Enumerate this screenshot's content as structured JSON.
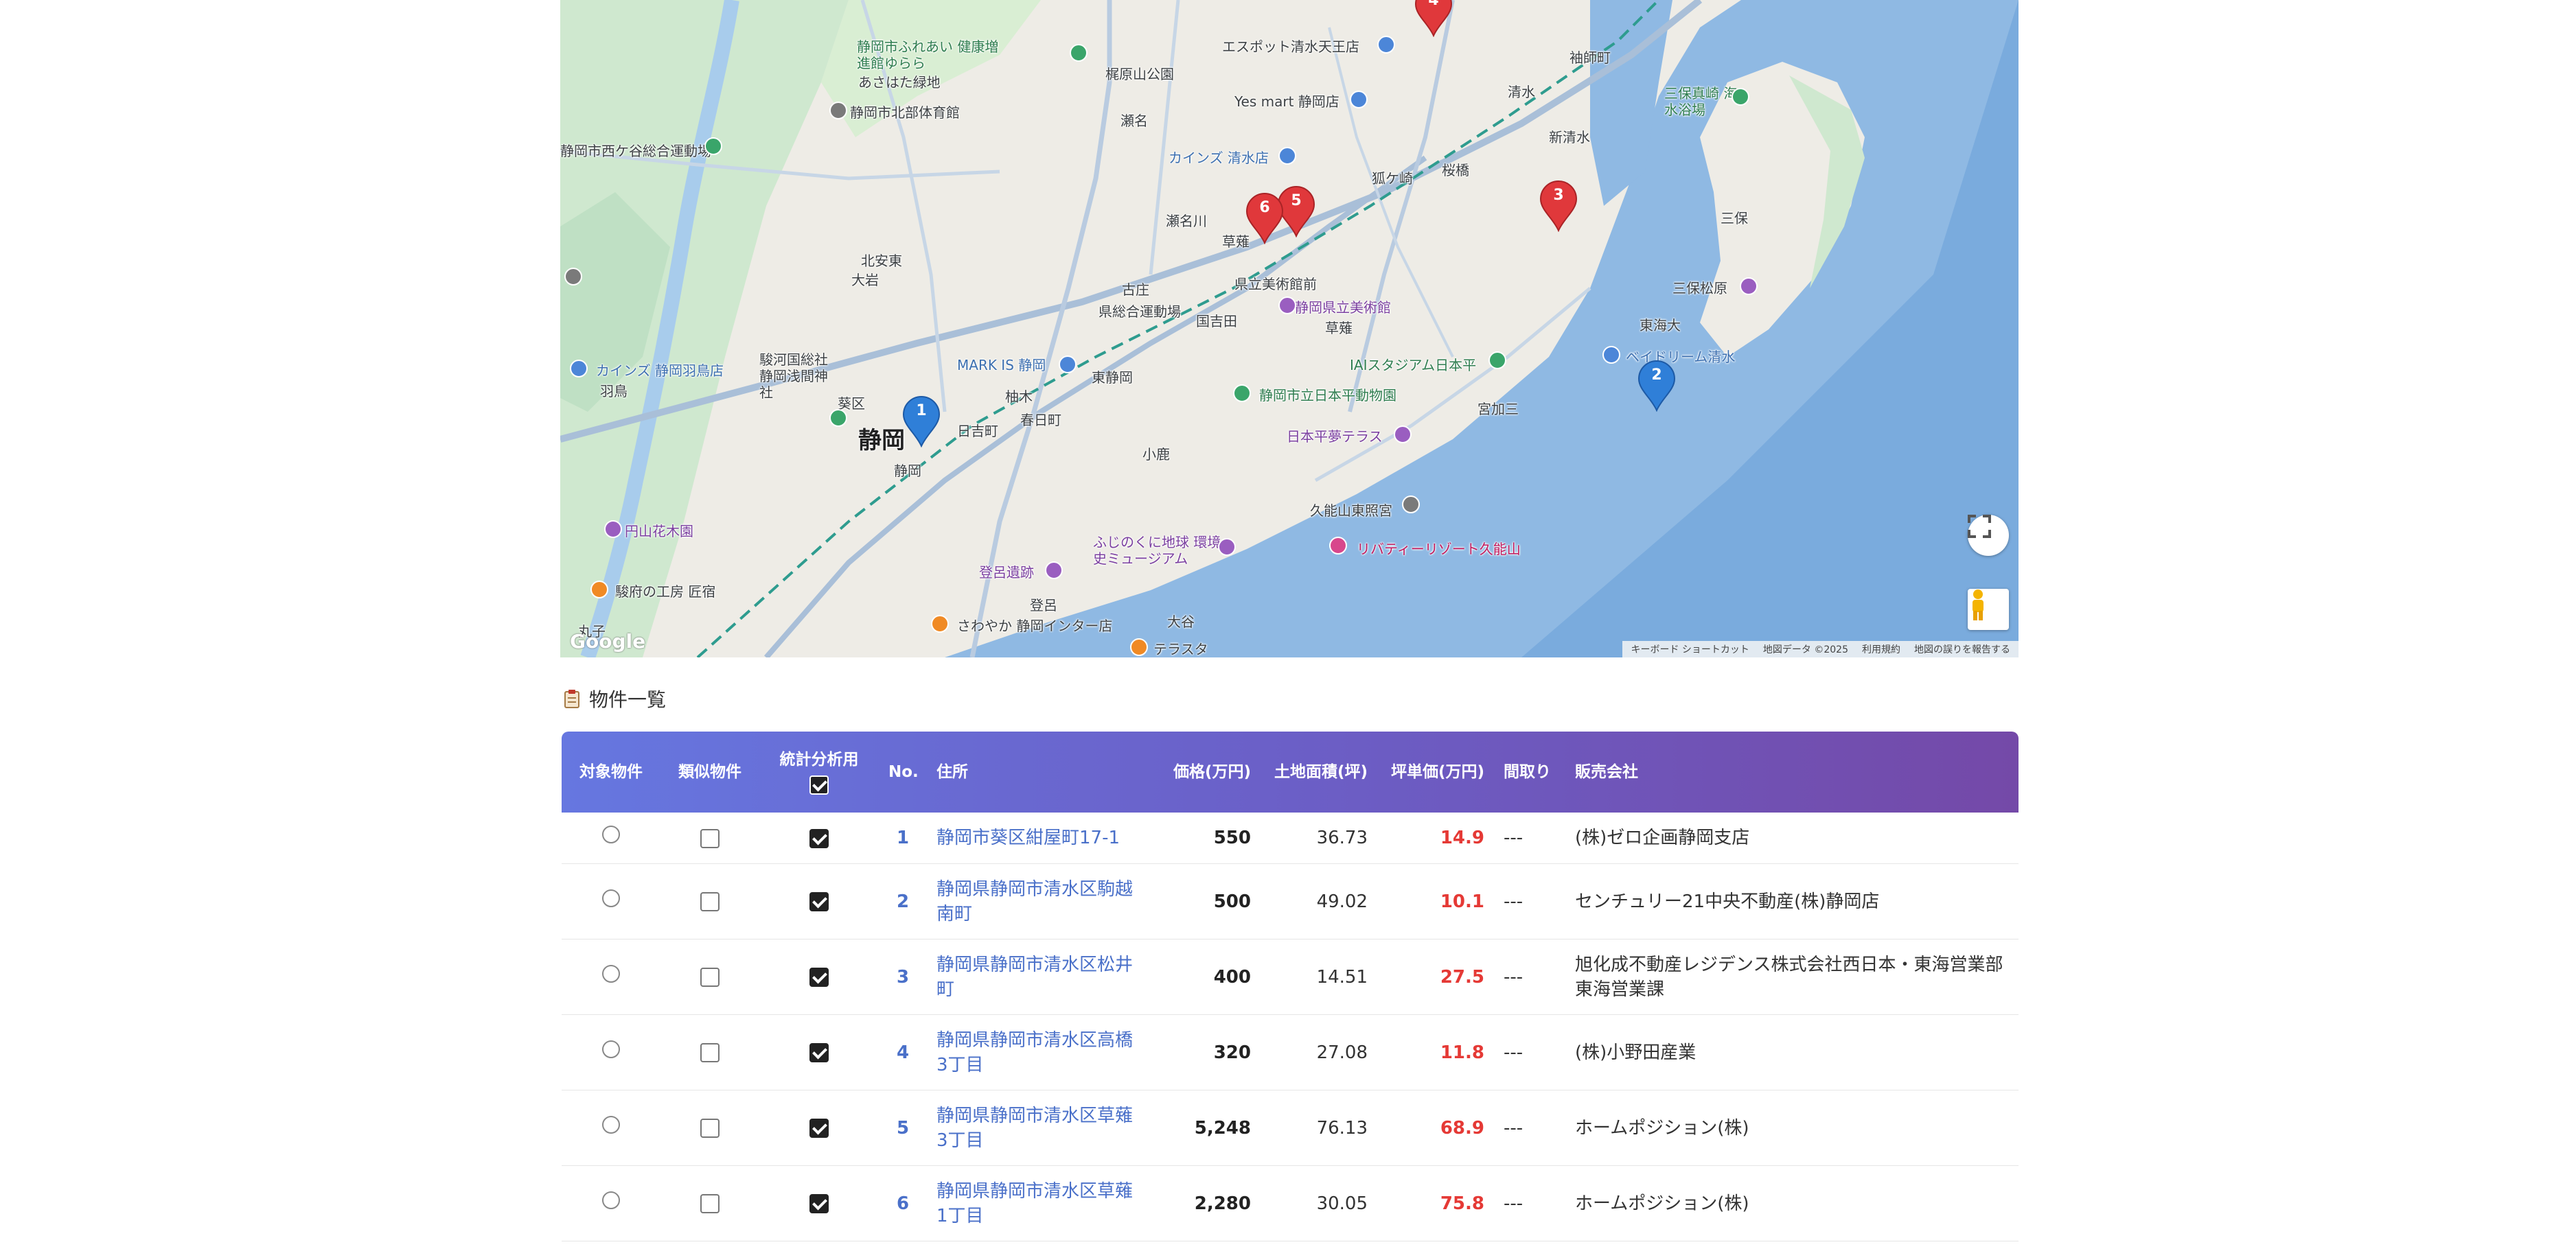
{
  "map": {
    "labels": {
      "shizuoka": "静岡",
      "shizuoka_station": "静岡",
      "hiyoshicho": "日吉町",
      "kasugacho": "春日町",
      "aoi": "葵区",
      "ahoebi": "安東",
      "kitaando": "北安東",
      "oiwa": "大岩",
      "higashi_shizuoka": "東静岡",
      "naginoki": "柚木",
      "kosaka": "小鹿",
      "kusanagi": "草薙",
      "kusanagi2": "草薙",
      "yoshida": "国吉田",
      "furusho": "古庄",
      "senami": "瀬名川",
      "senami2": "瀬名",
      "shimizu": "清水",
      "shin_shimizu": "新清水",
      "sakuragabashi": "桜橋",
      "kitsunegasaki": "狐ケ崎",
      "sodeshi": "袖師町",
      "miho": "三保",
      "miho_matsubara": "三保松原",
      "tokaidai": "東海大",
      "miyakami": "宮加三",
      "oya": "大谷",
      "tome": "登呂",
      "oya2": "大谷",
      "hadano": "羽鳥",
      "kawaramachi": "丸子",
      "mark_is": "MARK IS 静岡",
      "suruga_park": "駿河国総社 静岡浅間神社",
      "kenritsu_bijutsukan_st": "県立美術館前",
      "kenritsu_bijutsukan": "静岡県立美術館",
      "kensogo": "県総合運動場",
      "iai": "IAIスタジアム日本平",
      "zoo": "静岡市立日本平動物園",
      "nihondaira": "日本平夢テラス",
      "kunozan": "久能山東照宮",
      "liberty": "リバティーリゾート久能山",
      "fujinokuni": "ふじのくに地球 環境史ミュージアム",
      "toro": "登呂遺跡",
      "sawayaka": "さわやか 静岡インター店",
      "terrasta": "テラスタ",
      "maruko_koubou": "駿府の工房 匠宿",
      "enzan": "円山花木園",
      "kains_habu": "カインズ 静岡羽鳥店",
      "kains_shimizu": "カインズ 清水店",
      "yesmart": "Yes mart 静岡店",
      "espot": "エスポット清水天王店",
      "yurara": "静岡市ふれあい 健康増進館ゆらら",
      "asahina": "あさはた緑地",
      "kitabu": "静岡市北部体育館",
      "kajiwara": "梶原山公園",
      "nishigaya": "静岡市西ケ谷総合運動場",
      "dream": "ベイドリーム清水",
      "miho_kaisui": "三保真崎 海水浴場"
    },
    "markers": [
      {
        "label": "1",
        "color": "#2f7fd8"
      },
      {
        "label": "2",
        "color": "#2f7fd8"
      },
      {
        "label": "3",
        "color": "#e0383b"
      },
      {
        "label": "4",
        "color": "#e0383b"
      },
      {
        "label": "5",
        "color": "#e0383b"
      },
      {
        "label": "6",
        "color": "#e0383b"
      }
    ],
    "google_logo": "Google",
    "footer": {
      "shortcuts": "キーボード ショートカット",
      "mapdata": "地図データ ©2025",
      "terms": "利用規約",
      "report": "地図の誤りを報告する"
    }
  },
  "section": {
    "title": "物件一覧",
    "icon": "clipboard-icon"
  },
  "table": {
    "headers": {
      "target": "対象物件",
      "similar": "類似物件",
      "stats": "統計分析用",
      "no": "No.",
      "address": "住所",
      "price": "価格(万円)",
      "area": "土地面積(坪)",
      "unit_price": "坪単価(万円)",
      "layout": "間取り",
      "company": "販売会社"
    },
    "rows": [
      {
        "no": "1",
        "address": "静岡市葵区紺屋町17-1",
        "price": "550",
        "area": "36.73",
        "unit_price": "14.9",
        "layout": "---",
        "company": "(株)ゼロ企画静岡支店"
      },
      {
        "no": "2",
        "address": "静岡県静岡市清水区駒越南町",
        "price": "500",
        "area": "49.02",
        "unit_price": "10.1",
        "layout": "---",
        "company": "センチュリー21中央不動産(株)静岡店"
      },
      {
        "no": "3",
        "address": "静岡県静岡市清水区松井町",
        "price": "400",
        "area": "14.51",
        "unit_price": "27.5",
        "layout": "---",
        "company": "旭化成不動産レジデンス株式会社西日本・東海営業部東海営業課"
      },
      {
        "no": "4",
        "address": "静岡県静岡市清水区高橋3丁目",
        "price": "320",
        "area": "27.08",
        "unit_price": "11.8",
        "layout": "---",
        "company": "(株)小野田産業"
      },
      {
        "no": "5",
        "address": "静岡県静岡市清水区草薙3丁目",
        "price": "5,248",
        "area": "76.13",
        "unit_price": "68.9",
        "layout": "---",
        "company": "ホームポジション(株)"
      },
      {
        "no": "6",
        "address": "静岡県静岡市清水区草薙1丁目",
        "price": "2,280",
        "area": "30.05",
        "unit_price": "75.8",
        "layout": "---",
        "company": "ホームポジション(株)"
      }
    ]
  }
}
